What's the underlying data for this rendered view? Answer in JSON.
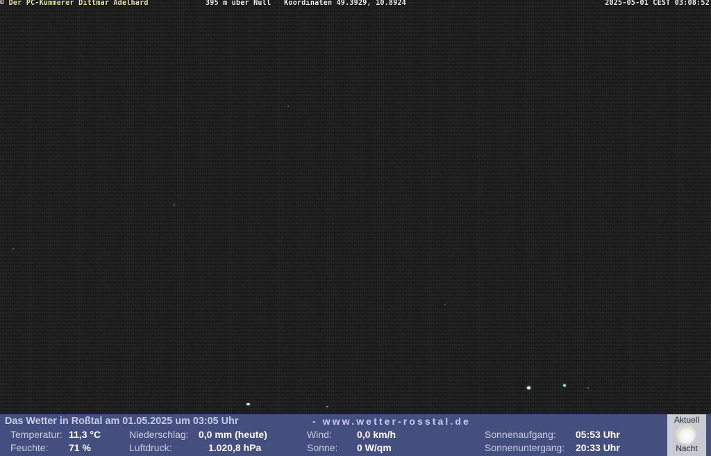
{
  "webcam": {
    "copyright_symbol": "©",
    "owner": "Der PC-Kümmerer Dittmar Adelhard",
    "altitude": "395 m über Null",
    "coordinates": "Koordinaten 49.3929, 10.8924",
    "timestamp": "2025-05-01 CEST 03:08:52",
    "caption_color": "#e8e89a"
  },
  "weather": {
    "title": "Das Wetter in Roßtal am 01.05.2025 um 03:05 Uhr",
    "website": "- www.wetter-rosstal.de",
    "temperature_label": "Temperatur:",
    "temperature_value": "11,3 °C",
    "humidity_label": "Feuchte:",
    "humidity_value": "71 %",
    "precipitation_label": "Niederschlag:",
    "precipitation_value": "0,0 mm (heute)",
    "pressure_label": "Luftdruck:",
    "pressure_value": "1.020,8 hPa",
    "wind_label": "Wind:",
    "wind_value": "0,0 km/h",
    "sun_label": "Sonne:",
    "sun_value": "0 W/qm",
    "sunrise_label": "Sonnenaufgang:",
    "sunrise_value": "05:53 Uhr",
    "sunset_label": "Sonnenuntergang:",
    "sunset_value": "20:33 Uhr",
    "panel_color": "#454f7f"
  },
  "moon": {
    "top_label": "Aktuell",
    "bottom_label": "Nacht",
    "icon": "full-moon-icon"
  }
}
